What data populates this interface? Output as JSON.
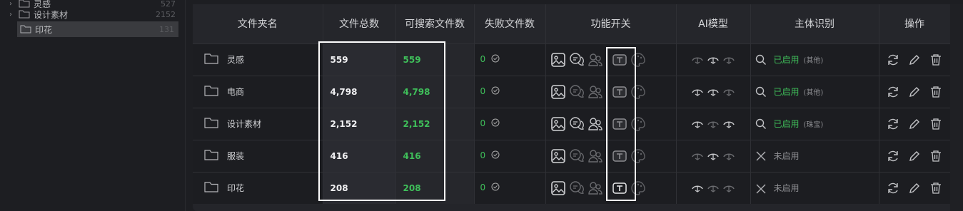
{
  "tree": {
    "items": [
      {
        "label": "灵感",
        "count": "527"
      },
      {
        "label": "设计素材",
        "count": "2152"
      },
      {
        "label": "印花",
        "count": "131"
      }
    ]
  },
  "table": {
    "headers": [
      "文件夹名",
      "文件总数",
      "可搜索文件数",
      "失败文件数",
      "功能开关",
      "AI模型",
      "主体识别",
      "操作"
    ],
    "rows": [
      {
        "name": "灵感",
        "total": "559",
        "searchable": "559",
        "failed": "0",
        "subject_status": "已启用",
        "subject_tag": "(其他)",
        "subject_on": true
      },
      {
        "name": "电商",
        "total": "4,798",
        "searchable": "4,798",
        "failed": "0",
        "subject_status": "已启用",
        "subject_tag": "(其他)",
        "subject_on": true
      },
      {
        "name": "设计素材",
        "total": "2,152",
        "searchable": "2,152",
        "failed": "0",
        "subject_status": "已启用",
        "subject_tag": "(珠宝)",
        "subject_on": true
      },
      {
        "name": "服装",
        "total": "416",
        "searchable": "416",
        "failed": "0",
        "subject_status": "未启用",
        "subject_tag": "",
        "subject_on": false
      },
      {
        "name": "印花",
        "total": "208",
        "searchable": "208",
        "failed": "0",
        "subject_status": "未启用",
        "subject_tag": "",
        "subject_on": false
      }
    ]
  },
  "colors": {
    "accent_green": "#3fbf5a",
    "highlight": "#ffffff"
  },
  "icons": [
    "folder-icon",
    "check-circle-icon",
    "image-icon",
    "chat-icon",
    "people-icon",
    "text-icon",
    "palette-icon",
    "ai-model-icon",
    "search-icon",
    "close-icon",
    "refresh-icon",
    "edit-icon",
    "delete-icon",
    "chevron-right-icon"
  ]
}
